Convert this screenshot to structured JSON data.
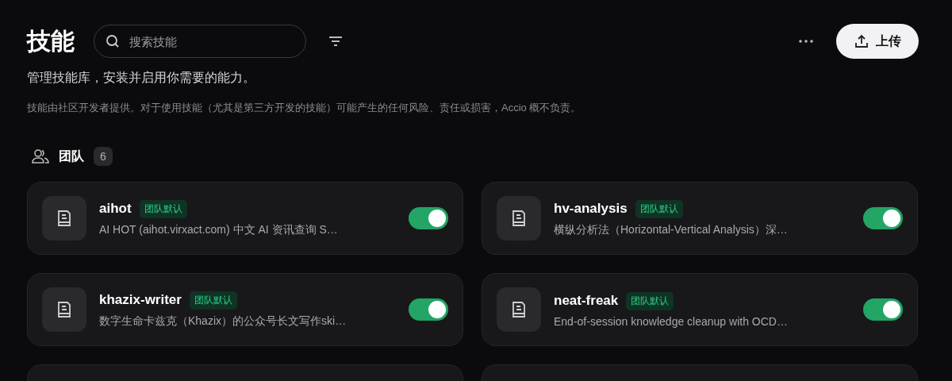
{
  "header": {
    "title": "技能",
    "search": {
      "placeholder": "搜索技能"
    },
    "upload_button": "上传"
  },
  "subtitle": "管理技能库，安装并启用你需要的能力。",
  "disclaimer": "技能由社区开发者提供。对于使用技能（尤其是第三方开发的技能）可能产生的任何风险、责任或损害，Accio 概不负责。",
  "section": {
    "title": "团队",
    "count": "6"
  },
  "skills": [
    {
      "name": "aihot",
      "tag": "团队默认",
      "description": "AI HOT (aihot.virxact.com) 中文 AI 资讯查询 S…",
      "on": true
    },
    {
      "name": "hv-analysis",
      "tag": "团队默认",
      "description": "横纵分析法（Horizontal-Vertical Analysis）深…",
      "on": true
    },
    {
      "name": "khazix-writer",
      "tag": "团队默认",
      "description": "数字生命卡兹克（Khazix）的公众号长文写作ski…",
      "on": true
    },
    {
      "name": "neat-freak",
      "tag": "团队默认",
      "description": "End-of-session knowledge cleanup with OCD…",
      "on": true
    }
  ]
}
